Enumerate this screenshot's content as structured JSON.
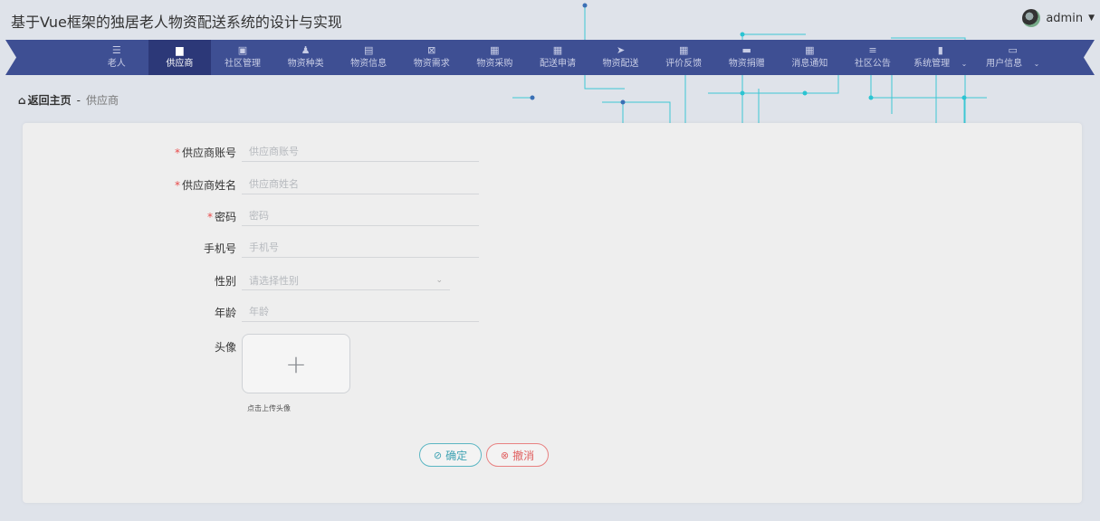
{
  "app": {
    "title": "基于Vue框架的独居老人物资配送系统的设计与实现",
    "user": "admin"
  },
  "nav": {
    "items": [
      {
        "label": "老人",
        "icon": "sliders-icon",
        "glyph": "☰"
      },
      {
        "label": "供应商",
        "icon": "monitor-icon",
        "glyph": "▆"
      },
      {
        "label": "社区管理",
        "icon": "chat-icon",
        "glyph": "▣"
      },
      {
        "label": "物资种类",
        "icon": "user-icon",
        "glyph": "♟"
      },
      {
        "label": "物资信息",
        "icon": "clipboard-icon",
        "glyph": "▤"
      },
      {
        "label": "物资需求",
        "icon": "box-icon",
        "glyph": "⊠"
      },
      {
        "label": "物资采购",
        "icon": "grid-icon",
        "glyph": "▦"
      },
      {
        "label": "配送申请",
        "icon": "grid-icon",
        "glyph": "▦"
      },
      {
        "label": "物资配送",
        "icon": "send-icon",
        "glyph": "➤"
      },
      {
        "label": "评价反馈",
        "icon": "grid-icon",
        "glyph": "▦"
      },
      {
        "label": "物资捐赠",
        "icon": "ticket-icon",
        "glyph": "▬"
      },
      {
        "label": "消息通知",
        "icon": "grid-icon",
        "glyph": "▦"
      },
      {
        "label": "社区公告",
        "icon": "list-icon",
        "glyph": "≡"
      },
      {
        "label": "系统管理",
        "icon": "bar-chart-icon",
        "glyph": "▮"
      },
      {
        "label": "用户信息",
        "icon": "card-icon",
        "glyph": "▭"
      }
    ],
    "active_index": 1
  },
  "breadcrumb": {
    "home": "返回主页",
    "separator": "-",
    "current": "供应商"
  },
  "form": {
    "account": {
      "label": "供应商账号",
      "placeholder": "供应商账号",
      "value": ""
    },
    "name": {
      "label": "供应商姓名",
      "placeholder": "供应商姓名",
      "value": ""
    },
    "password": {
      "label": "密码",
      "placeholder": "密码",
      "value": ""
    },
    "phone": {
      "label": "手机号",
      "placeholder": "手机号",
      "value": ""
    },
    "gender": {
      "label": "性别",
      "placeholder": "请选择性别"
    },
    "age": {
      "label": "年龄",
      "placeholder": "年龄",
      "value": ""
    },
    "avatar": {
      "label": "头像",
      "hint": "点击上传头像"
    },
    "required_mark": "*"
  },
  "buttons": {
    "confirm": "确定",
    "cancel": "撤消"
  },
  "colors": {
    "nav_bg": "#3e4f93",
    "nav_active": "#2c3878",
    "confirm": "#3fa3b3",
    "cancel": "#e06060",
    "required": "#e84a4a"
  }
}
